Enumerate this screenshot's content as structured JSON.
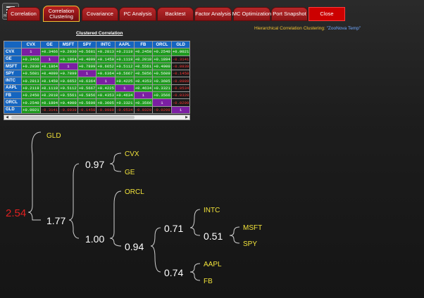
{
  "tabs": [
    {
      "label": "Correlation"
    },
    {
      "label": "Correlation Clustering"
    },
    {
      "label": "Covariance"
    },
    {
      "label": "PC Analysis"
    },
    {
      "label": "Backtest"
    },
    {
      "label": "Factor Analysis"
    },
    {
      "label": "MC Optimization"
    },
    {
      "label": "Port Snapshot"
    },
    {
      "label": "Close"
    }
  ],
  "menu_label": "MENU",
  "table_title": "Clustered Correlation",
  "cluster_title_prefix": "Hierarchical Correlation Clustering:",
  "model_name": "\"ZooNova Temp\"",
  "columns": [
    "CVX",
    "GE",
    "MSFT",
    "SPY",
    "INTC",
    "AAPL",
    "FB",
    "ORCL",
    "GLD"
  ],
  "rows": [
    {
      "label": "CVX",
      "cells": [
        "1",
        "+0.3466",
        "+0.2930",
        "+0.5681",
        "+0.2813",
        "+0.2119",
        "+0.2450",
        "+0.2540",
        "+0.0021"
      ]
    },
    {
      "label": "GE",
      "cells": [
        "+0.3466",
        "1",
        "+0.1864",
        "+0.4099",
        "+0.1450",
        "+0.1119",
        "+0.2018",
        "+0.1894",
        "-0.3141"
      ]
    },
    {
      "label": "MSFT",
      "cells": [
        "+0.2930",
        "+0.1864",
        "1",
        "+0.7899",
        "+0.6652",
        "+0.5112",
        "+0.5561",
        "+0.4900",
        "-0.0939"
      ]
    },
    {
      "label": "SPY",
      "cells": [
        "+0.5681",
        "+0.4099",
        "+0.7899",
        "1",
        "+0.6364",
        "+0.5667",
        "+0.5856",
        "+0.5609",
        "-0.1458"
      ]
    },
    {
      "label": "INTC",
      "cells": [
        "+0.2813",
        "+0.1450",
        "+0.6652",
        "+0.6364",
        "1",
        "+0.4225",
        "+0.4353",
        "+0.3605",
        "-0.0989"
      ]
    },
    {
      "label": "AAPL",
      "cells": [
        "+0.2119",
        "+0.1119",
        "+0.5112",
        "+0.5667",
        "+0.4225",
        "1",
        "+0.4634",
        "+0.3321",
        "-0.0534"
      ]
    },
    {
      "label": "FB",
      "cells": [
        "+0.2450",
        "+0.2018",
        "+0.5561",
        "+0.5856",
        "+0.4353",
        "+0.4634",
        "1",
        "+0.3566",
        "-0.0320"
      ]
    },
    {
      "label": "ORCL",
      "cells": [
        "+0.2540",
        "+0.1894",
        "+0.4900",
        "+0.5609",
        "+0.3605",
        "+0.3321",
        "+0.3566",
        "1",
        "-0.0299"
      ]
    },
    {
      "label": "GLD",
      "cells": [
        "+0.0021",
        "-0.3141",
        "-0.0939",
        "-0.1458",
        "-0.0989",
        "-0.0534",
        "-0.0320",
        "-0.0299",
        "1"
      ]
    }
  ],
  "colors": {
    "positive": "#1e9a1e",
    "negative": "#ff3333",
    "diagonal": "#7b1fa2",
    "header": "#1565c0",
    "leaf": "#f1e23a",
    "root": "#e02020",
    "node": "#ffffff"
  },
  "dendrogram": {
    "root": "2.54",
    "nodes": [
      "1.77",
      "0.97",
      "1.00",
      "0.94",
      "0.71",
      "0.51",
      "0.74"
    ],
    "leaves": [
      "GLD",
      "CVX",
      "GE",
      "ORCL",
      "INTC",
      "MSFT",
      "SPY",
      "AAPL",
      "FB"
    ]
  }
}
